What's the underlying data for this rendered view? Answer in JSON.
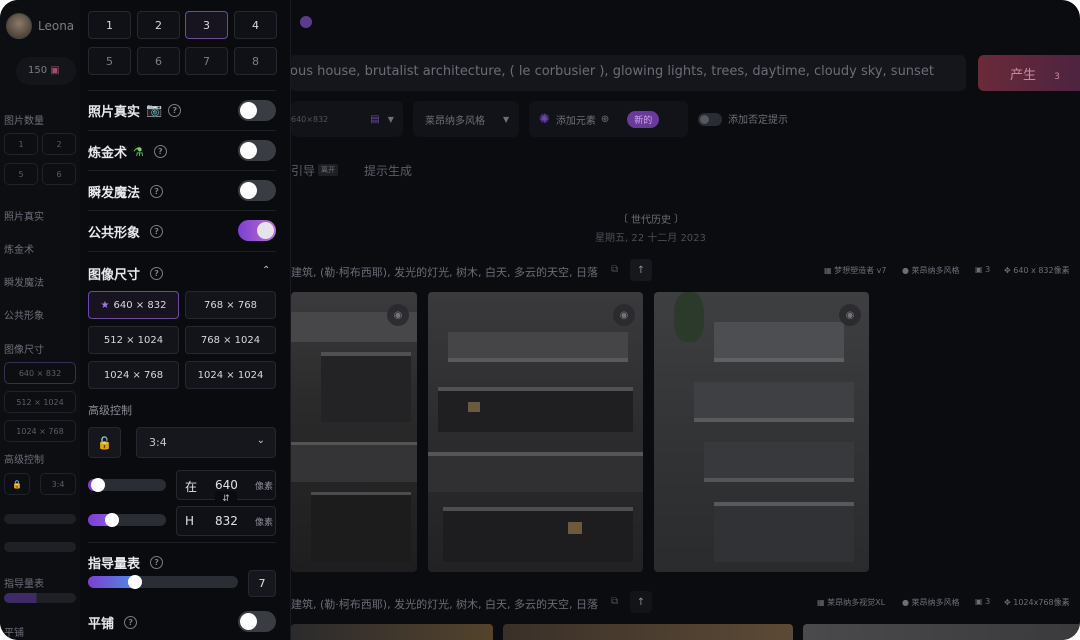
{
  "bg_sidebar": {
    "user_name": "Leona",
    "tokens": "150",
    "num_images_label": "图片数量",
    "nums_row1": [
      "1",
      "2"
    ],
    "nums_row2": [
      "5",
      "6"
    ],
    "photo_real_label": "照片真实",
    "alchemy_label": "炼金术",
    "prompt_magic_label": "瞬发魔法",
    "public_label": "公共形象",
    "image_size_label": "图像尺寸",
    "size1": "640 × 832",
    "size2": "512 × 1024",
    "size3": "1024 × 768",
    "advanced_label": "高级控制",
    "aspect": "3:4",
    "guidance_label": "指导量表",
    "tiling_label": "平铺"
  },
  "main": {
    "prompt_text": "ous house, brutalist architecture, ( le corbusier ), glowing lights, trees, daytime, cloudy sky, sunset",
    "generate_label": "产生",
    "generate_cost": "3",
    "dims_hint": "640×832",
    "style_select": "莱昂纳多风格",
    "add_element_label": "添加元素",
    "new_badge": "新的",
    "negative_prompt_label": "添加否定提示",
    "tab_guidance": "引导",
    "tab_guidance_badge": "离开",
    "tab_prompt_gen": "提示生成",
    "history_title": "世代历史",
    "history_date": "星期五, 22 十二月 2023",
    "gen1_prompt": "建筑, (勒·柯布西耶), 发光的灯光, 树木, 白天, 多云的天空, 日落",
    "gen1_model": "梦想塑造者 v7",
    "gen1_style": "莱昂纳多风格",
    "gen1_count": "3",
    "gen1_dims": "640 x 832像素",
    "gen2_prompt": "建筑, (勒·柯布西耶), 发光的灯光, 树木, 白天, 多云的天空, 日落",
    "gen2_model": "莱昂纳多视觉XL",
    "gen2_style": "莱昂纳多风格",
    "gen2_count": "3",
    "gen2_dims": "1024x768像素"
  },
  "panel": {
    "num_images": [
      "1",
      "2",
      "3",
      "4",
      "5",
      "6",
      "7",
      "8"
    ],
    "selected_num": "3",
    "photo_real_label": "照片真实",
    "alchemy_label": "炼金术",
    "prompt_magic_label": "瞬发魔法",
    "public_label": "公共形象",
    "photo_real_on": false,
    "alchemy_on": false,
    "prompt_magic_on": false,
    "public_on": true,
    "image_size_label": "图像尺寸",
    "sizes": [
      "640 × 832",
      "768 × 768",
      "512 × 1024",
      "768 × 1024",
      "1024 × 768",
      "1024 × 1024"
    ],
    "selected_size": "640 × 832",
    "advanced_label": "高级控制",
    "aspect_ratio": "3:4",
    "width_prefix": "在",
    "width_value": "640",
    "height_prefix": "H",
    "height_value": "832",
    "unit": "像素",
    "guidance_label": "指导量表",
    "guidance_value": "7",
    "tiling_label": "平铺",
    "tiling_on": false
  },
  "colors": {
    "accent": "#7c3fd0",
    "accent2": "#c06fd6",
    "background": "#0b0c10"
  }
}
